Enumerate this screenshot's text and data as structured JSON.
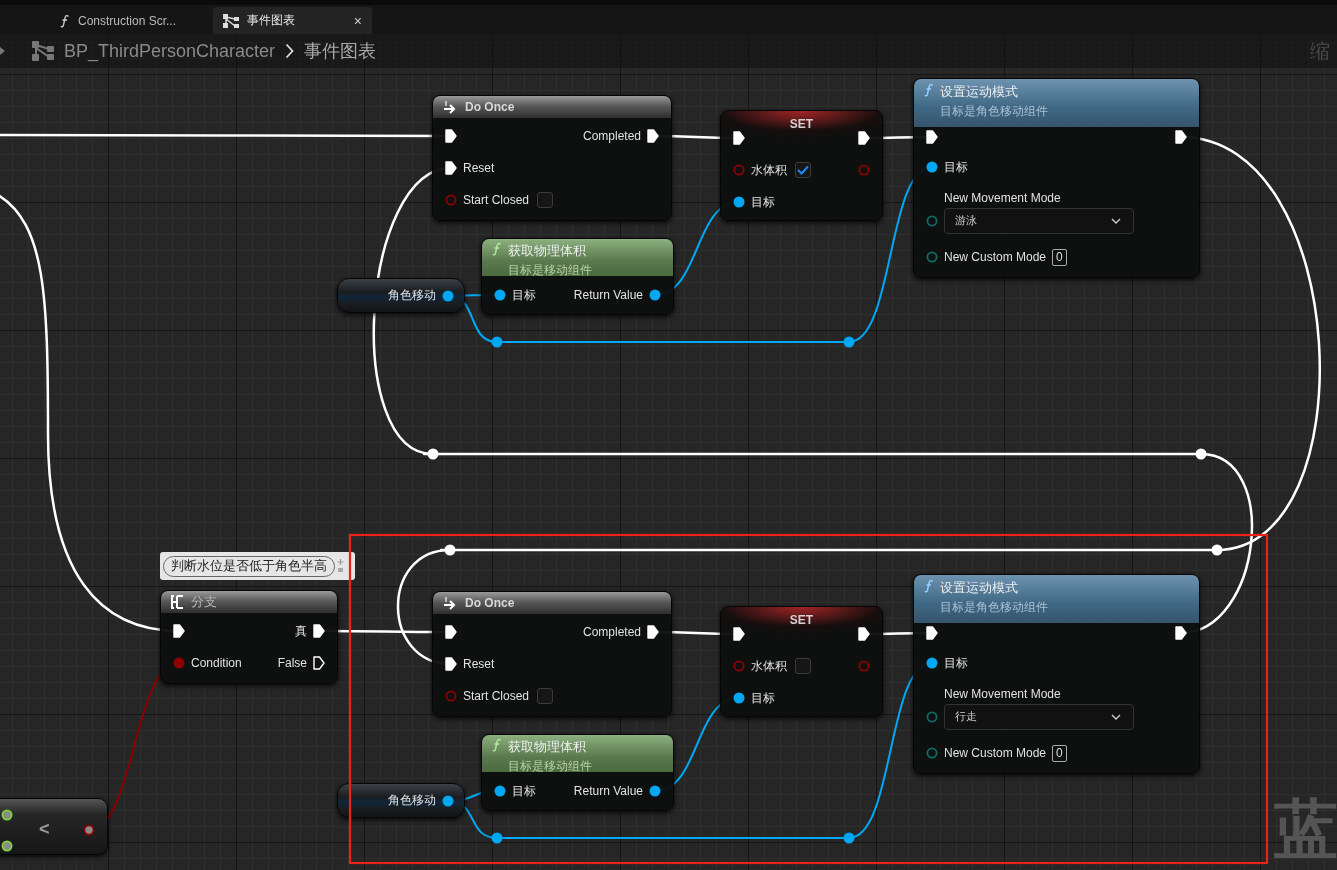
{
  "tabs": [
    {
      "kind": "function",
      "label": "Construction Scr...",
      "selected": false
    },
    {
      "kind": "graph",
      "label": "事件图表",
      "selected": true,
      "close": "×"
    }
  ],
  "breadcrumb": {
    "path": [
      "BP_ThirdPersonCharacter",
      "事件图表"
    ]
  },
  "zoom_label": "缩",
  "graph_label": "蓝",
  "comment": {
    "text": "判断水位是否低于角色半高"
  },
  "nodes": [
    {
      "kind": "macro",
      "title": "Do Once",
      "rows": [
        {
          "left": {
            "kind": "exec",
            "connected": true
          },
          "right": {
            "kind": "exec",
            "label": "Completed",
            "connected": true
          }
        },
        {
          "left": {
            "kind": "exec",
            "label": "Reset",
            "connected": true
          }
        },
        {
          "left": {
            "kind": "bool",
            "label": "Start Closed",
            "connected": false,
            "checked": false
          }
        }
      ]
    },
    {
      "kind": "set",
      "title": "SET",
      "rows": [
        {
          "left": {
            "kind": "exec",
            "connected": true
          },
          "right": {
            "kind": "exec",
            "connected": true
          }
        },
        {
          "left": {
            "kind": "bool",
            "label": "水体积",
            "connected": false,
            "checked": true
          },
          "right": {
            "kind": "bool",
            "connected": false
          }
        },
        {
          "left": {
            "kind": "object",
            "label": "目标",
            "connected": true
          }
        }
      ]
    },
    {
      "kind": "function",
      "title": "设置运动模式",
      "subtitle": "目标是角色移动组件",
      "rows": [
        {
          "left": {
            "kind": "exec",
            "connected": true
          },
          "right": {
            "kind": "exec",
            "connected": true
          }
        },
        {
          "left": {
            "kind": "object",
            "label": "目标",
            "connected": true
          }
        },
        {
          "left": {
            "kind": "enum",
            "label": "New Movement Mode",
            "value": "游泳",
            "connected": false
          }
        },
        {
          "left": {
            "kind": "int",
            "label": "New Custom Mode",
            "value": "0",
            "connected": false
          }
        }
      ]
    },
    {
      "kind": "variable",
      "rows": [
        {
          "right": {
            "kind": "object",
            "label": "角色移动",
            "connected": true
          }
        }
      ]
    },
    {
      "kind": "pure_function",
      "title": "获取物理体积",
      "subtitle": "目标是移动组件",
      "rows": [
        {
          "left": {
            "kind": "object",
            "label": "目标",
            "connected": true
          },
          "right": {
            "kind": "object",
            "label": "Return Value",
            "connected": true
          }
        }
      ]
    },
    {
      "kind": "branch",
      "title": "分支",
      "rows": [
        {
          "left": {
            "kind": "exec",
            "connected": true
          },
          "right": {
            "kind": "exec",
            "label": "真",
            "connected": true
          }
        },
        {
          "left": {
            "kind": "bool",
            "label": "Condition",
            "connected": true
          },
          "right": {
            "kind": "exec",
            "label": "False",
            "connected": false
          }
        }
      ]
    },
    {
      "kind": "macro",
      "title": "Do Once",
      "rows": [
        {
          "left": {
            "kind": "exec",
            "connected": true
          },
          "right": {
            "kind": "exec",
            "label": "Completed",
            "connected": true
          }
        },
        {
          "left": {
            "kind": "exec",
            "label": "Reset",
            "connected": true
          }
        },
        {
          "left": {
            "kind": "bool",
            "label": "Start Closed",
            "connected": false,
            "checked": false
          }
        }
      ]
    },
    {
      "kind": "set",
      "title": "SET",
      "rows": [
        {
          "left": {
            "kind": "exec",
            "connected": true
          },
          "right": {
            "kind": "exec",
            "connected": true
          }
        },
        {
          "left": {
            "kind": "bool",
            "label": "水体积",
            "connected": false,
            "checked": false
          },
          "right": {
            "kind": "bool",
            "connected": false
          }
        },
        {
          "left": {
            "kind": "object",
            "label": "目标",
            "connected": true
          }
        }
      ]
    },
    {
      "kind": "function",
      "title": "设置运动模式",
      "subtitle": "目标是角色移动组件",
      "rows": [
        {
          "left": {
            "kind": "exec",
            "connected": true
          },
          "right": {
            "kind": "exec",
            "connected": true
          }
        },
        {
          "left": {
            "kind": "object",
            "label": "目标",
            "connected": true
          }
        },
        {
          "left": {
            "kind": "enum",
            "label": "New Movement Mode",
            "value": "行走",
            "connected": false
          }
        },
        {
          "left": {
            "kind": "int",
            "label": "New Custom Mode",
            "value": "0",
            "connected": false
          }
        }
      ]
    },
    {
      "kind": "variable",
      "rows": [
        {
          "right": {
            "kind": "object",
            "label": "角色移动",
            "connected": true
          }
        }
      ]
    },
    {
      "kind": "pure_function",
      "title": "获取物理体积",
      "subtitle": "目标是移动组件",
      "rows": [
        {
          "left": {
            "kind": "object",
            "label": "目标",
            "connected": true
          },
          "right": {
            "kind": "object",
            "label": "Return Value",
            "connected": true
          }
        }
      ]
    },
    {
      "kind": "operator",
      "symbol": "<",
      "rows": [
        {
          "left": {
            "kind": "float",
            "connected": true
          }
        },
        {
          "right": {
            "kind": "bool",
            "connected": true
          }
        },
        {
          "left": {
            "kind": "float",
            "connected": true
          }
        }
      ]
    }
  ]
}
